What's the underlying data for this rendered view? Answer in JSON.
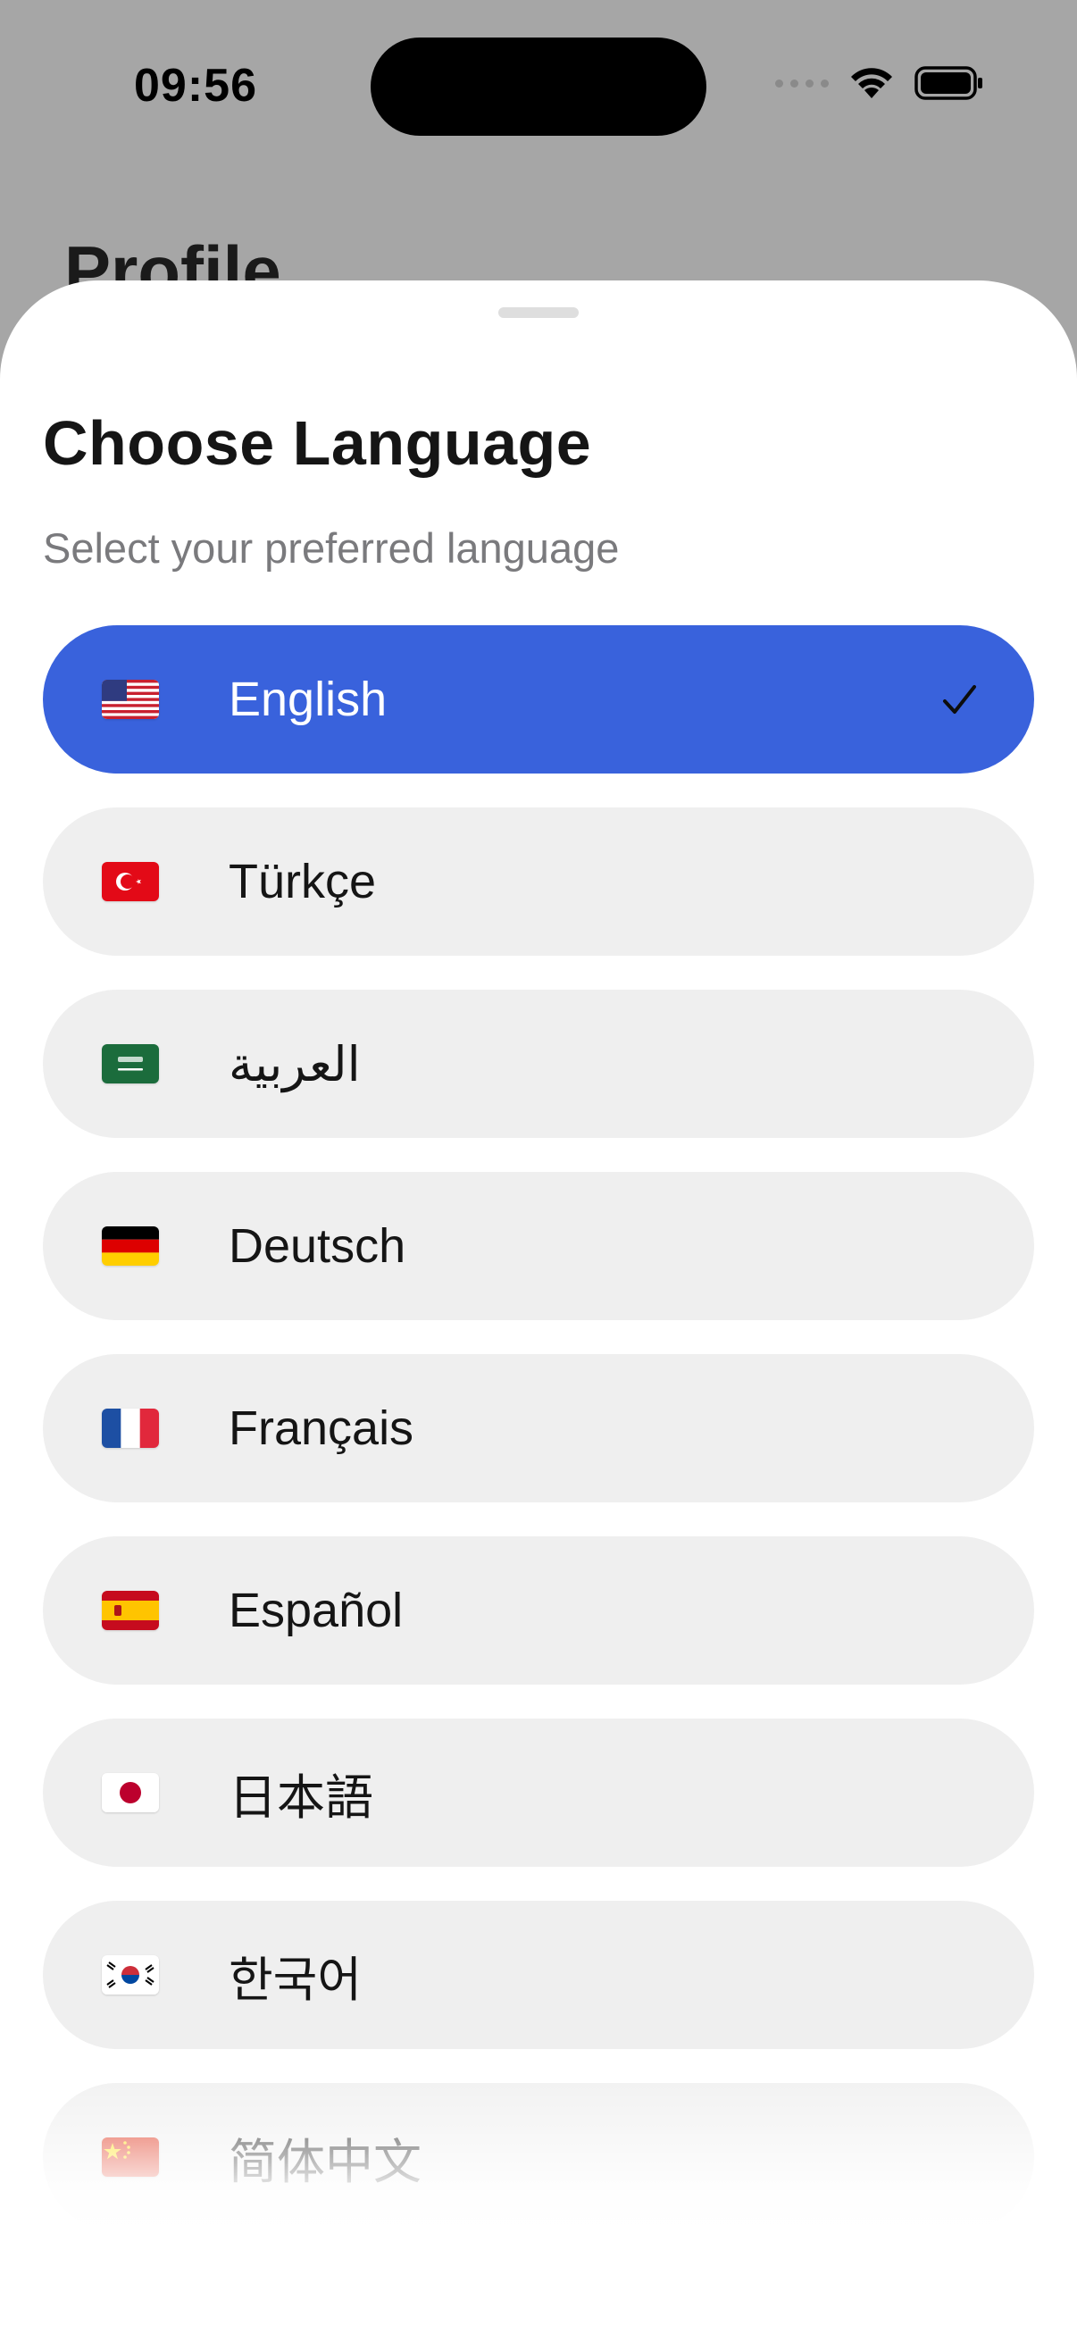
{
  "status_bar": {
    "time": "09:56"
  },
  "background": {
    "title": "Profile"
  },
  "sheet": {
    "title": "Choose Language",
    "subtitle": "Select your preferred language",
    "languages": [
      {
        "label": "English",
        "flag": "us-flag-icon",
        "selected": true
      },
      {
        "label": "Türkçe",
        "flag": "turkey-flag-icon",
        "selected": false
      },
      {
        "label": "العربية",
        "flag": "saudi-arabia-flag-icon",
        "selected": false
      },
      {
        "label": "Deutsch",
        "flag": "germany-flag-icon",
        "selected": false
      },
      {
        "label": "Français",
        "flag": "france-flag-icon",
        "selected": false
      },
      {
        "label": "Español",
        "flag": "spain-flag-icon",
        "selected": false
      },
      {
        "label": "日本語",
        "flag": "japan-flag-icon",
        "selected": false
      },
      {
        "label": "한국어",
        "flag": "korea-flag-icon",
        "selected": false
      },
      {
        "label": "简体中文",
        "flag": "china-flag-icon",
        "selected": false
      }
    ]
  },
  "colors": {
    "accent": "#3962DC",
    "row_background": "#EFEFEF",
    "backdrop": "#A6A6A6"
  }
}
